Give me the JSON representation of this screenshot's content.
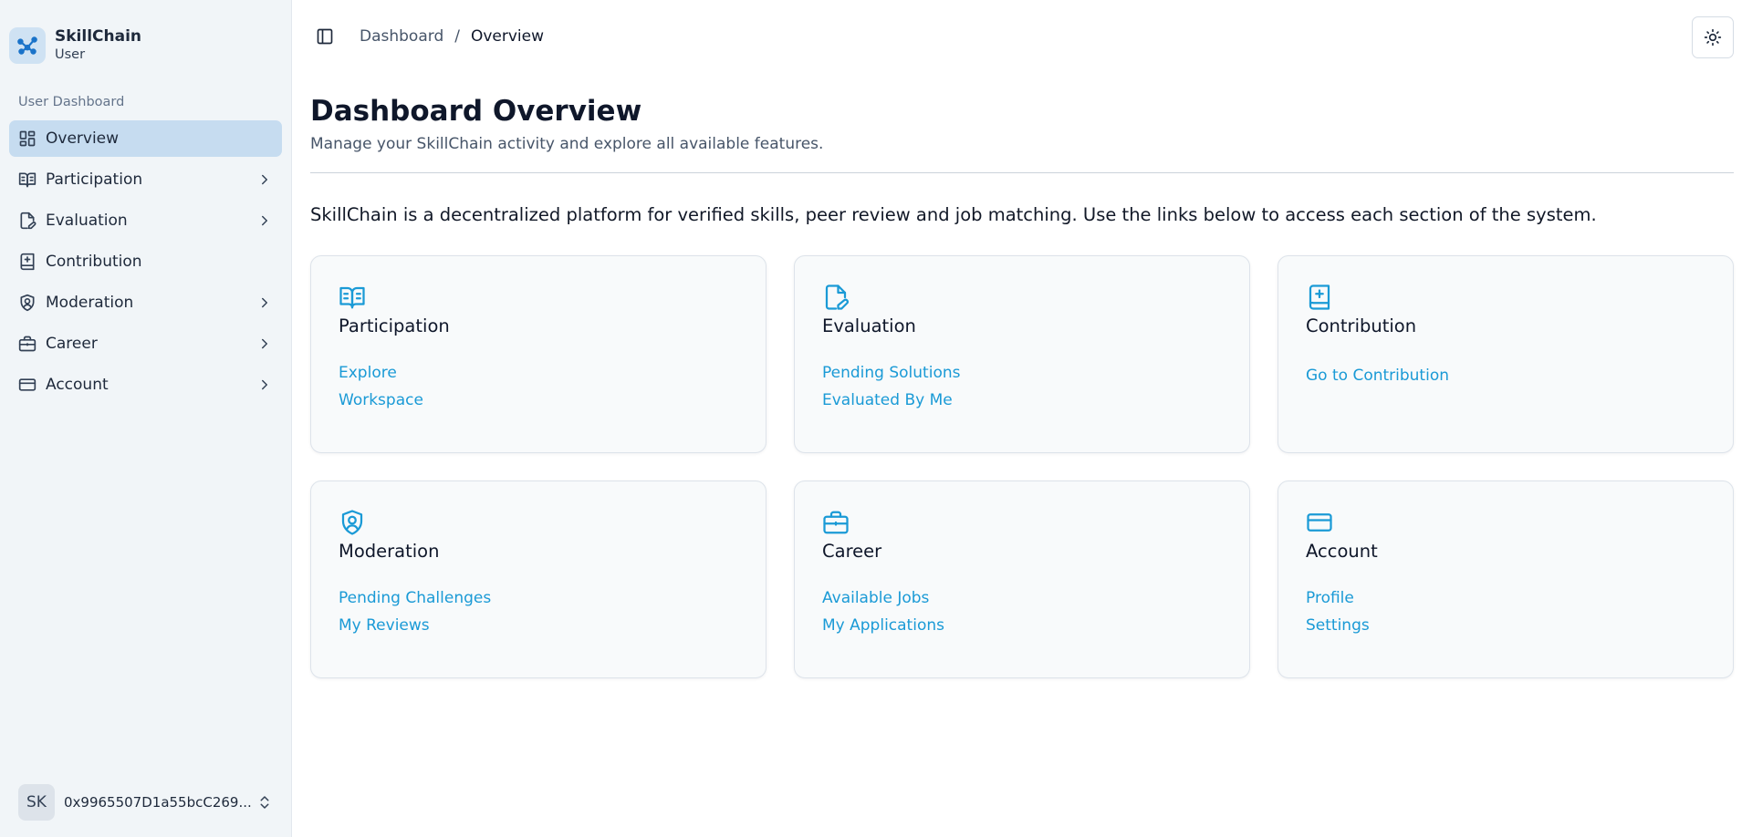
{
  "brand": {
    "name": "SkillChain",
    "role": "User"
  },
  "sidebar": {
    "group_label": "User Dashboard",
    "items": [
      {
        "label": "Overview",
        "icon": "dashboard-grid-icon",
        "active": true,
        "expandable": false
      },
      {
        "label": "Participation",
        "icon": "book-open-icon",
        "active": false,
        "expandable": true
      },
      {
        "label": "Evaluation",
        "icon": "file-pen-icon",
        "active": false,
        "expandable": true
      },
      {
        "label": "Contribution",
        "icon": "book-plus-icon",
        "active": false,
        "expandable": false
      },
      {
        "label": "Moderation",
        "icon": "shield-user-icon",
        "active": false,
        "expandable": true
      },
      {
        "label": "Career",
        "icon": "briefcase-icon",
        "active": false,
        "expandable": true
      },
      {
        "label": "Account",
        "icon": "credit-card-icon",
        "active": false,
        "expandable": true
      }
    ],
    "user": {
      "initials": "SK",
      "wallet": "0x9965507D1a55bcC269..."
    }
  },
  "header": {
    "breadcrumb": {
      "parent": "Dashboard",
      "separator": "/",
      "current": "Overview"
    },
    "theme_icon": "sun-icon"
  },
  "main": {
    "title": "Dashboard Overview",
    "subtitle": "Manage your SkillChain activity and explore all available features.",
    "intro": "SkillChain is a decentralized platform for verified skills, peer review and job matching. Use the links below to access each section of the system.",
    "cards": [
      {
        "title": "Participation",
        "icon": "book-open-icon",
        "links": [
          "Explore",
          "Workspace"
        ]
      },
      {
        "title": "Evaluation",
        "icon": "file-pen-icon",
        "links": [
          "Pending Solutions",
          "Evaluated By Me"
        ]
      },
      {
        "title": "Contribution",
        "icon": "book-plus-icon",
        "links": [
          "Go to Contribution"
        ]
      },
      {
        "title": "Moderation",
        "icon": "shield-user-icon",
        "links": [
          "Pending Challenges",
          "My Reviews"
        ]
      },
      {
        "title": "Career",
        "icon": "briefcase-icon",
        "links": [
          "Available Jobs",
          "My Applications"
        ]
      },
      {
        "title": "Account",
        "icon": "credit-card-icon",
        "links": [
          "Profile",
          "Settings"
        ]
      }
    ]
  },
  "colors": {
    "accent": "#1a9ad6",
    "sidebar_bg": "#f1f5f8",
    "active_item_bg": "#c6dcf0",
    "card_bg": "#f8fafb"
  }
}
